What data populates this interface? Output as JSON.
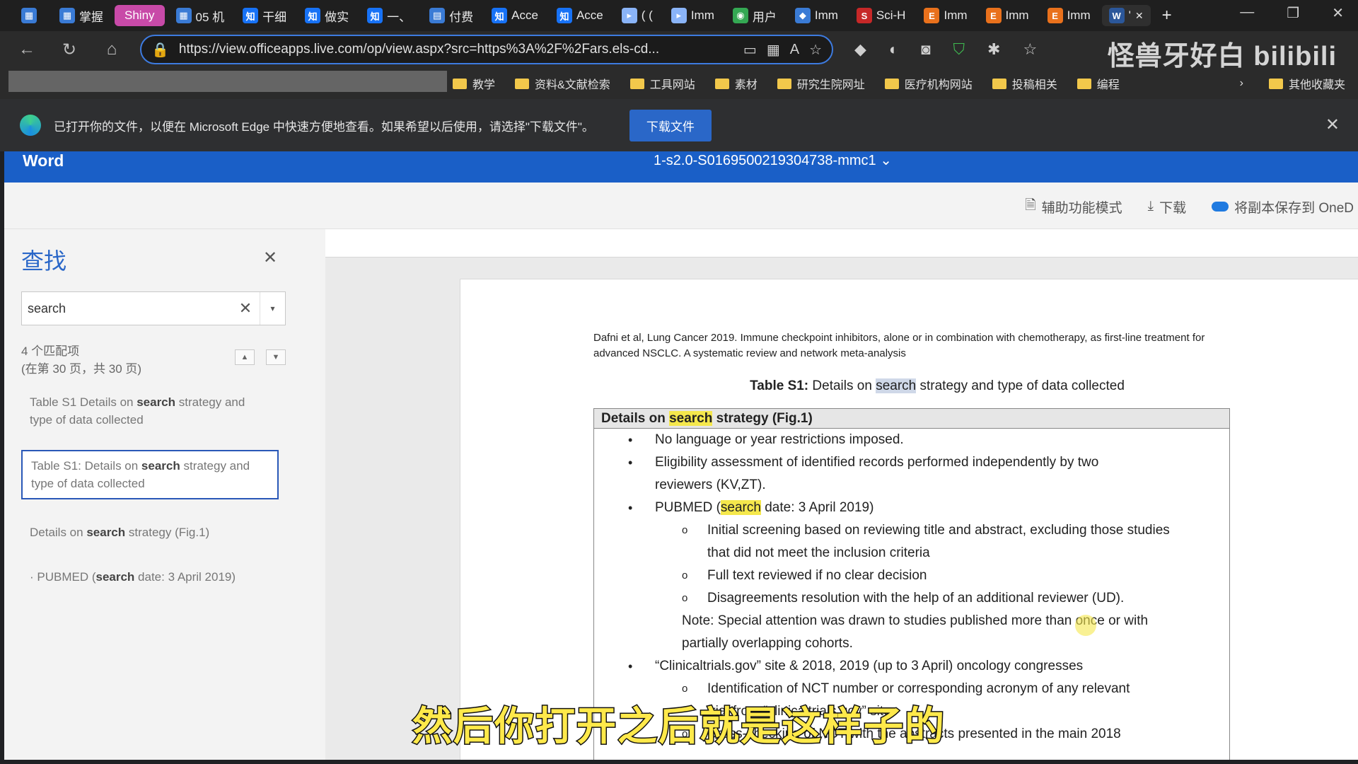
{
  "tabs": [
    {
      "label": "",
      "icon": "calendar-icon",
      "color": "#3a7bd5"
    },
    {
      "label": "掌握",
      "icon": "calendar-icon",
      "color": "#3a7bd5"
    },
    {
      "label": "Shiny",
      "icon": "",
      "color": "#c84aa8"
    },
    {
      "label": "05 机",
      "icon": "calendar-icon",
      "color": "#3a7bd5"
    },
    {
      "label": "干细",
      "icon": "zhihu-icon",
      "color": "#1772f6"
    },
    {
      "label": "做实",
      "icon": "zhihu-icon",
      "color": "#1772f6"
    },
    {
      "label": "一、",
      "icon": "zhihu-icon",
      "color": "#1772f6"
    },
    {
      "label": "付费",
      "icon": "doc-icon",
      "color": "#3a7bd5"
    },
    {
      "label": "Acce",
      "icon": "zhihu-icon",
      "color": "#1772f6"
    },
    {
      "label": "Acce",
      "icon": "zhihu-icon",
      "color": "#1772f6"
    },
    {
      "label": "( (",
      "icon": "page-icon",
      "color": "#8ab4f8"
    },
    {
      "label": "Imm",
      "icon": "page-icon",
      "color": "#8ab4f8"
    },
    {
      "label": "用户",
      "icon": "chrome-icon",
      "color": "#34a853"
    },
    {
      "label": "Imm",
      "icon": "diamond-icon",
      "color": "#3a7bd5"
    },
    {
      "label": "Sci-H",
      "icon": "scihub-icon",
      "color": "#c62828"
    },
    {
      "label": "Imm",
      "icon": "elsevier-icon",
      "color": "#e9711c"
    },
    {
      "label": "Imm",
      "icon": "elsevier-icon",
      "color": "#e9711c"
    },
    {
      "label": "Imm",
      "icon": "elsevier-icon",
      "color": "#e9711c"
    },
    {
      "label": "'",
      "icon": "word-icon",
      "color": "#2b579a",
      "active": true
    }
  ],
  "address": {
    "url": "https://view.officeapps.live.com/op/view.aspx?src=https%3A%2F%2Fars.els-cd..."
  },
  "watermark": "怪兽牙好白 bilibili",
  "bookmarks": [
    "教学",
    "资料&文献检索",
    "工具网站",
    "素材",
    "研究生院网址",
    "医疗机构网站",
    "投稿相关",
    "编程"
  ],
  "bookmarks_other": "其他收藏夹",
  "infobar": {
    "message": "已打开你的文件，以便在 Microsoft Edge 中快速方便地查看。如果希望以后使用，请选择\"下载文件\"。",
    "button": "下载文件"
  },
  "word": {
    "app_name": "Word",
    "doc_name": "1-s2.0-S0169500219304738-mmc1",
    "actions": [
      "辅助功能模式",
      "下载",
      "将副本保存到 OneD"
    ]
  },
  "find": {
    "title": "查找",
    "query": "search",
    "match_count": "4 个匹配项",
    "match_pages": "(在第 30 页，共 30 页)",
    "results": [
      {
        "before": "Table S1 Details on ",
        "match": "search",
        "after": " strategy and type of data collected"
      },
      {
        "before": "Table S1: Details on ",
        "match": "search",
        "after": " strategy and type of data collected"
      },
      {
        "before": "Details on ",
        "match": "search",
        "after": " strategy (Fig.1)"
      },
      {
        "before": "· PUBMED (",
        "match": "search",
        "after": " date: 3 April 2019)"
      }
    ]
  },
  "document": {
    "citation": "Dafni et al, Lung Cancer 2019. Immune checkpoint inhibitors, alone or in combination with chemotherapy, as first-line treatment for advanced NSCLC. A systematic review and network meta-analysis",
    "table_title_bold": "Table S1:",
    "table_title_pre": " Details on ",
    "table_title_match": "search",
    "table_title_post": " strategy and type of data collected",
    "table_header_pre": "Details on ",
    "table_header_match": "search",
    "table_header_post": " strategy (Fig.1)",
    "items": {
      "b1": "No language or year restrictions imposed.",
      "b2a": "Eligibility assessment of identified records performed independently by two",
      "b2b": "reviewers (KV,ZT).",
      "b3_pre": "PUBMED (",
      "b3_match": "search",
      "b3_post": " date: 3 April 2019)",
      "s1a": "Initial screening based on reviewing title and abstract, excluding those studies",
      "s1b": "that did not meet the inclusion criteria",
      "s2": "Full text reviewed if no clear decision",
      "s3": "Disagreements resolution with the help of an additional reviewer (UD).",
      "note_a": "Note: Special attention was drawn to studies published more than once or with",
      "note_b": "partially overlapping cohorts.",
      "b4": "“Clinicaltrials.gov” site & 2018, 2019 (up to 3 April) oncology congresses",
      "s4": "Identification of NCT number or corresponding acronym of any relevant",
      "s4b": "trial from “clinicaltrials.gov” site",
      "s5": "Cross-checking of NCT with the abstracts presented in the main 2018"
    }
  },
  "subtitle": "然后你打开之后就是这样子的"
}
